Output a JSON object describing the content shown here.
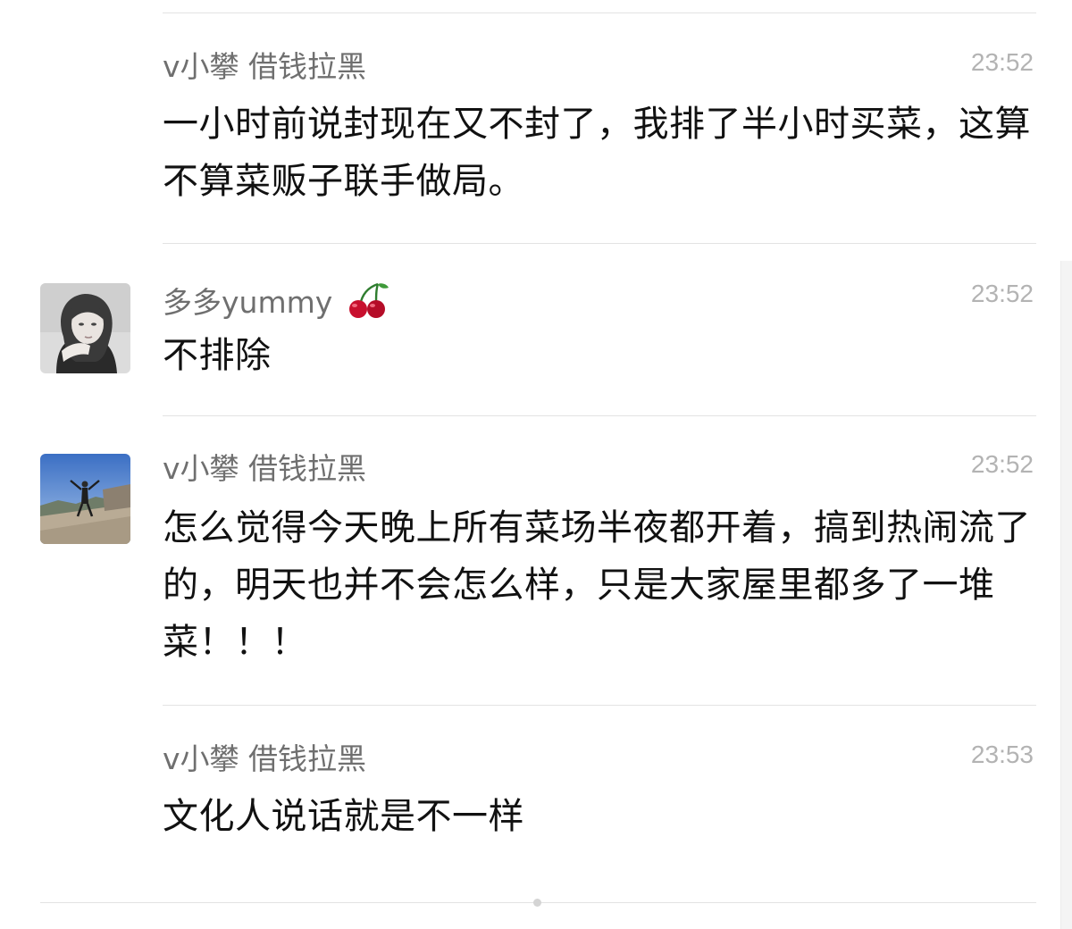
{
  "comments": [
    {
      "author": "v小攀  借钱拉黑",
      "time": "23:52",
      "text": "一小时前说封现在又不封了，我排了半小时买菜，这算不算菜贩子联手做局。"
    },
    {
      "author": "多多yummy",
      "author_emoji": "cherry-icon",
      "time": "23:52",
      "text": "不排除"
    },
    {
      "author": "v小攀  借钱拉黑",
      "time": "23:52",
      "text": "怎么觉得今天晚上所有菜场半夜都开着，搞到热闹流了的，明天也并不会怎么样，只是大家屋里都多了一堆菜！！！"
    },
    {
      "author": "v小攀  借钱拉黑",
      "time": "23:53",
      "text": "文化人说话就是不一样"
    }
  ],
  "colors": {
    "name": "#6f6f6f",
    "time": "#b3b3b3",
    "text": "#111111",
    "divider": "#e3e3e3",
    "cherry": "#c8102e"
  }
}
